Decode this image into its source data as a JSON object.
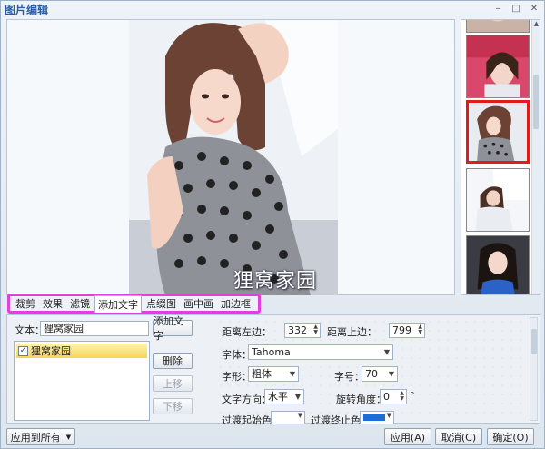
{
  "window": {
    "title": "图片编辑"
  },
  "preview": {
    "watermark": "狸窝家园"
  },
  "tabs": [
    {
      "label": "裁剪"
    },
    {
      "label": "效果"
    },
    {
      "label": "滤镜"
    },
    {
      "label": "添加文字",
      "active": true
    },
    {
      "label": "点缀图"
    },
    {
      "label": "画中画"
    },
    {
      "label": "加边框"
    }
  ],
  "text_panel": {
    "text_label": "文本：",
    "text_value": "狸窝家园",
    "add_text_button": "添加文字",
    "list_items": [
      {
        "label": "狸窝家园",
        "checked": true
      }
    ],
    "delete_button": "删除",
    "move_up_button": "上移",
    "move_down_button": "下移",
    "left_label": "距离左边：",
    "left_value": "332",
    "top_label": "距离上边：",
    "top_value": "799",
    "font_label": "字体：",
    "font_value": "Tahoma",
    "style_label": "字形：",
    "style_value": "粗体",
    "size_label": "字号：",
    "size_value": "70",
    "direction_label": "文字方向：",
    "direction_value": "水平",
    "rotation_label": "旋转角度：",
    "rotation_value": "0",
    "rotation_unit": "°",
    "gradient_start_label": "过渡起始色：",
    "gradient_start_color": "#ffffff",
    "gradient_end_label": "过渡终止色：",
    "gradient_end_color": "#1a6fd6"
  },
  "footer": {
    "apply_all_button": "应用到所有",
    "apply_button": "应用(A)",
    "cancel_button": "取消(C)",
    "ok_button": "确定(O)"
  },
  "colors": {
    "selected_thumb_border": "#e01b1b",
    "tab_highlight": "#e040e0",
    "title": "#2a5da8"
  }
}
